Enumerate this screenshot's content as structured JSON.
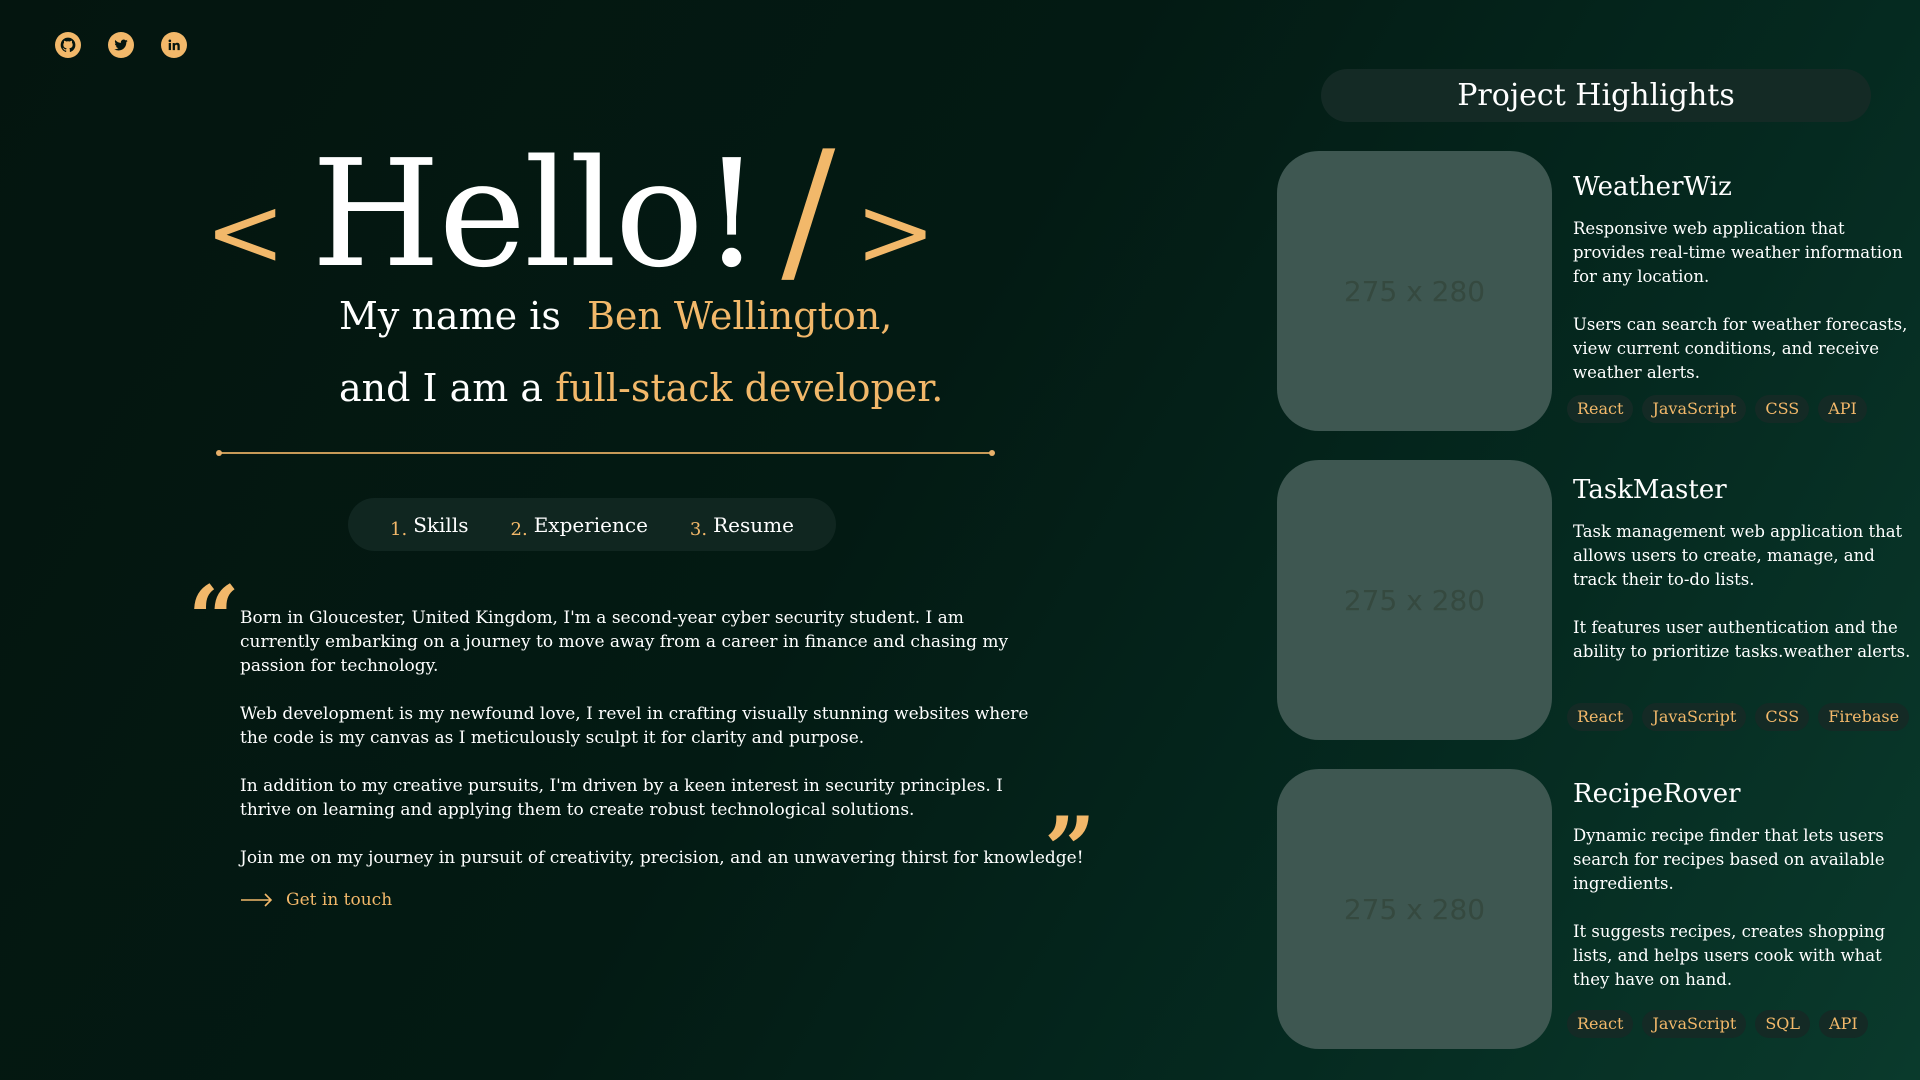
{
  "socials": [
    {
      "icon": "github-icon"
    },
    {
      "icon": "twitter-icon"
    },
    {
      "icon": "linkedin-icon"
    }
  ],
  "hero": {
    "open_bracket": "<",
    "hello": "Hello!",
    "slash": "/",
    "close_bracket": ">",
    "line1_prefix": "My name is",
    "line1_name": "Ben Wellington,",
    "line2_prefix": "and I am a",
    "line2_role": "full-stack developer."
  },
  "nav": [
    {
      "num": "1.",
      "label": "Skills"
    },
    {
      "num": "2.",
      "label": "Experience"
    },
    {
      "num": "3.",
      "label": "Resume"
    }
  ],
  "bio": {
    "open_quote": "“",
    "close_quote": "”",
    "paragraphs": [
      "Born in Gloucester, United Kingdom, I'm a second-year cyber security student. I am currently embarking on a journey to move away from a career in finance and chasing my passion for technology.",
      "Web development is my newfound love, I revel in crafting visually stunning websites where the code is my canvas as I meticulously sculpt it for clarity and purpose.",
      "In addition to my creative pursuits, I'm driven by a keen interest in security principles. I thrive on learning and applying them to create robust technological solutions.",
      "Join me on my journey in pursuit of creativity, precision, and an unwavering thirst for knowledge!"
    ],
    "cta": "Get in touch"
  },
  "projects_header": "Project Highlights",
  "projects": [
    {
      "title": "WeatherWiz",
      "placeholder": "275 x 280",
      "desc1": "Responsive web application that provides real-time weather information for any location.",
      "desc2": "Users can search for weather forecasts, view current conditions, and receive weather alerts.",
      "tags": [
        "React",
        "JavaScript",
        "CSS",
        "API"
      ]
    },
    {
      "title": "TaskMaster",
      "placeholder": "275 x 280",
      "desc1": "Task management web application that allows users to create, manage, and track their to-do lists.",
      "desc2": "It features user authentication and the ability to prioritize tasks.weather alerts.",
      "tags": [
        "React",
        "JavaScript",
        "CSS",
        "Firebase"
      ]
    },
    {
      "title": "RecipeRover",
      "placeholder": "275 x 280",
      "desc1": "Dynamic recipe finder that lets users search for recipes based on available ingredients.",
      "desc2": "It suggests recipes, creates shopping lists, and helps users cook with what they have on hand.",
      "tags": [
        "React",
        "JavaScript",
        "SQL",
        "API"
      ]
    }
  ],
  "colors": {
    "accent": "#f2b86a",
    "bg": "#04150f",
    "pill": "#142a25",
    "thumb": "#3e5751"
  }
}
